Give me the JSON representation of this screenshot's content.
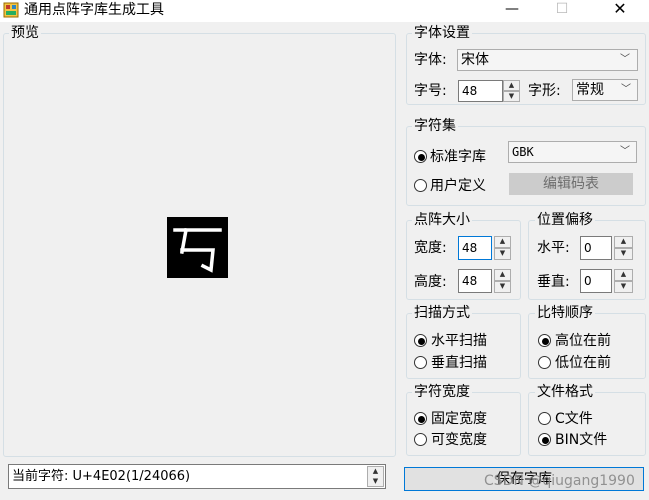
{
  "window": {
    "title": "通用点阵字库生成工具",
    "minimize_glyph": "—",
    "maximize_glyph": "☐",
    "close_glyph": "✕"
  },
  "preview": {
    "legend": "预览"
  },
  "current_char": {
    "label": "当前字符: U+4E02(1/24066)"
  },
  "font_settings": {
    "legend": "字体设置",
    "font_label": "字体:",
    "font_value": "宋体",
    "size_label": "字号:",
    "size_value": "48",
    "style_label": "字形:",
    "style_value": "常规"
  },
  "charset": {
    "legend": "字符集",
    "standard_label": "标准字库",
    "standard_value": "GBK",
    "custom_label": "用户定义",
    "edit_button": "编辑码表"
  },
  "dot_size": {
    "legend": "点阵大小",
    "width_label": "宽度:",
    "width_value": "48",
    "height_label": "高度:",
    "height_value": "48"
  },
  "offset": {
    "legend": "位置偏移",
    "h_label": "水平:",
    "h_value": "0",
    "v_label": "垂直:",
    "v_value": "0"
  },
  "scan": {
    "legend": "扫描方式",
    "horizontal": "水平扫描",
    "vertical": "垂直扫描"
  },
  "bit_order": {
    "legend": "比特顺序",
    "high_first": "高位在前",
    "low_first": "低位在前"
  },
  "char_width": {
    "legend": "字符宽度",
    "fixed": "固定宽度",
    "variable": "可变宽度"
  },
  "file_format": {
    "legend": "文件格式",
    "c_file": "C文件",
    "bin_file": "BIN文件"
  },
  "save_button": "保存字库",
  "watermark": "CSDN @qiugang1990",
  "colors": {
    "accent": "#0078d7",
    "preview_bg": "#000000",
    "glyph": "#ffffff"
  }
}
